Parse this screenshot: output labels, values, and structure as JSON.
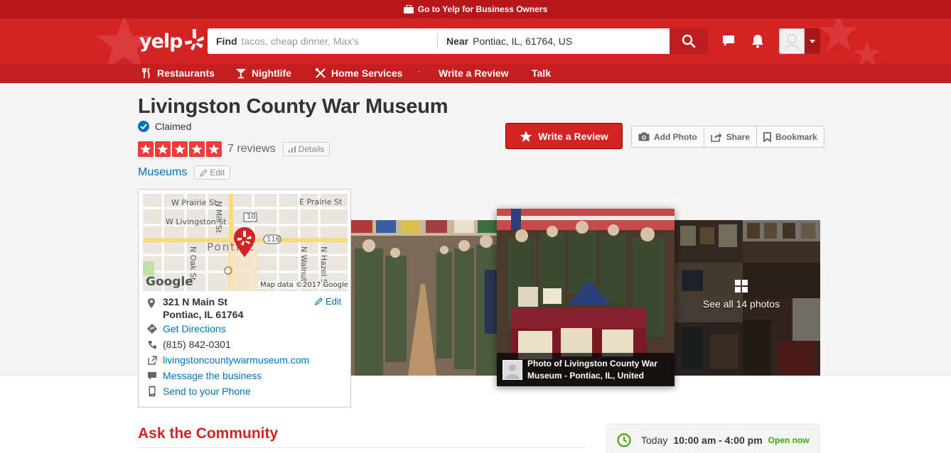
{
  "topbar": {
    "text": "Go to Yelp for Business Owners"
  },
  "header": {
    "logo_text": "yelp",
    "find_label": "Find",
    "find_placeholder": "tacos, cheap dinner, Max's",
    "near_label": "Near",
    "near_value": "Pontiac, IL, 61764, US"
  },
  "nav": {
    "items": [
      {
        "label": "Restaurants",
        "icon": "fork-knife-icon"
      },
      {
        "label": "Nightlife",
        "icon": "cocktail-icon"
      },
      {
        "label": "Home Services",
        "icon": "tools-icon"
      },
      {
        "label": "Write a Review"
      },
      {
        "label": "Talk"
      }
    ],
    "separator": "·"
  },
  "business": {
    "name": "Livingston County War Museum",
    "claimed": "Claimed",
    "reviews": "7 reviews",
    "rating": 5,
    "details": "Details",
    "category": "Museums",
    "edit": "Edit"
  },
  "actions": {
    "write_review": "Write a Review",
    "add_photo": "Add Photo",
    "share": "Share",
    "bookmark": "Bookmark"
  },
  "map": {
    "streets": [
      "W Prairie St",
      "E Prairie St",
      "N Mill St",
      "W Livingston St",
      "N Oak St",
      "N Walnut",
      "N Hazel St"
    ],
    "town_label": "Pontiac",
    "route_a": "10",
    "route_b": "116",
    "google": "Google",
    "attribution": "Map data ©2017 Google"
  },
  "address": {
    "line1": "321 N Main St",
    "line2": "Pontiac, IL 61764",
    "edit": "Edit",
    "directions": "Get Directions",
    "phone": "(815) 842-0301",
    "website": "livingstoncountywarmuseum.com",
    "message": "Message the business",
    "send_phone": "Send to your Phone"
  },
  "photos": {
    "caption": "Photo of Livingston County War Museum - Pontiac, IL, United",
    "see_all": "See all 14 photos"
  },
  "community": {
    "title": "Ask the Community"
  },
  "hours": {
    "today": "Today",
    "time": "10:00 am - 4:00 pm",
    "status": "Open now"
  },
  "colors": {
    "brand": "#d32323",
    "link": "#0073bb",
    "open": "#41a700"
  }
}
